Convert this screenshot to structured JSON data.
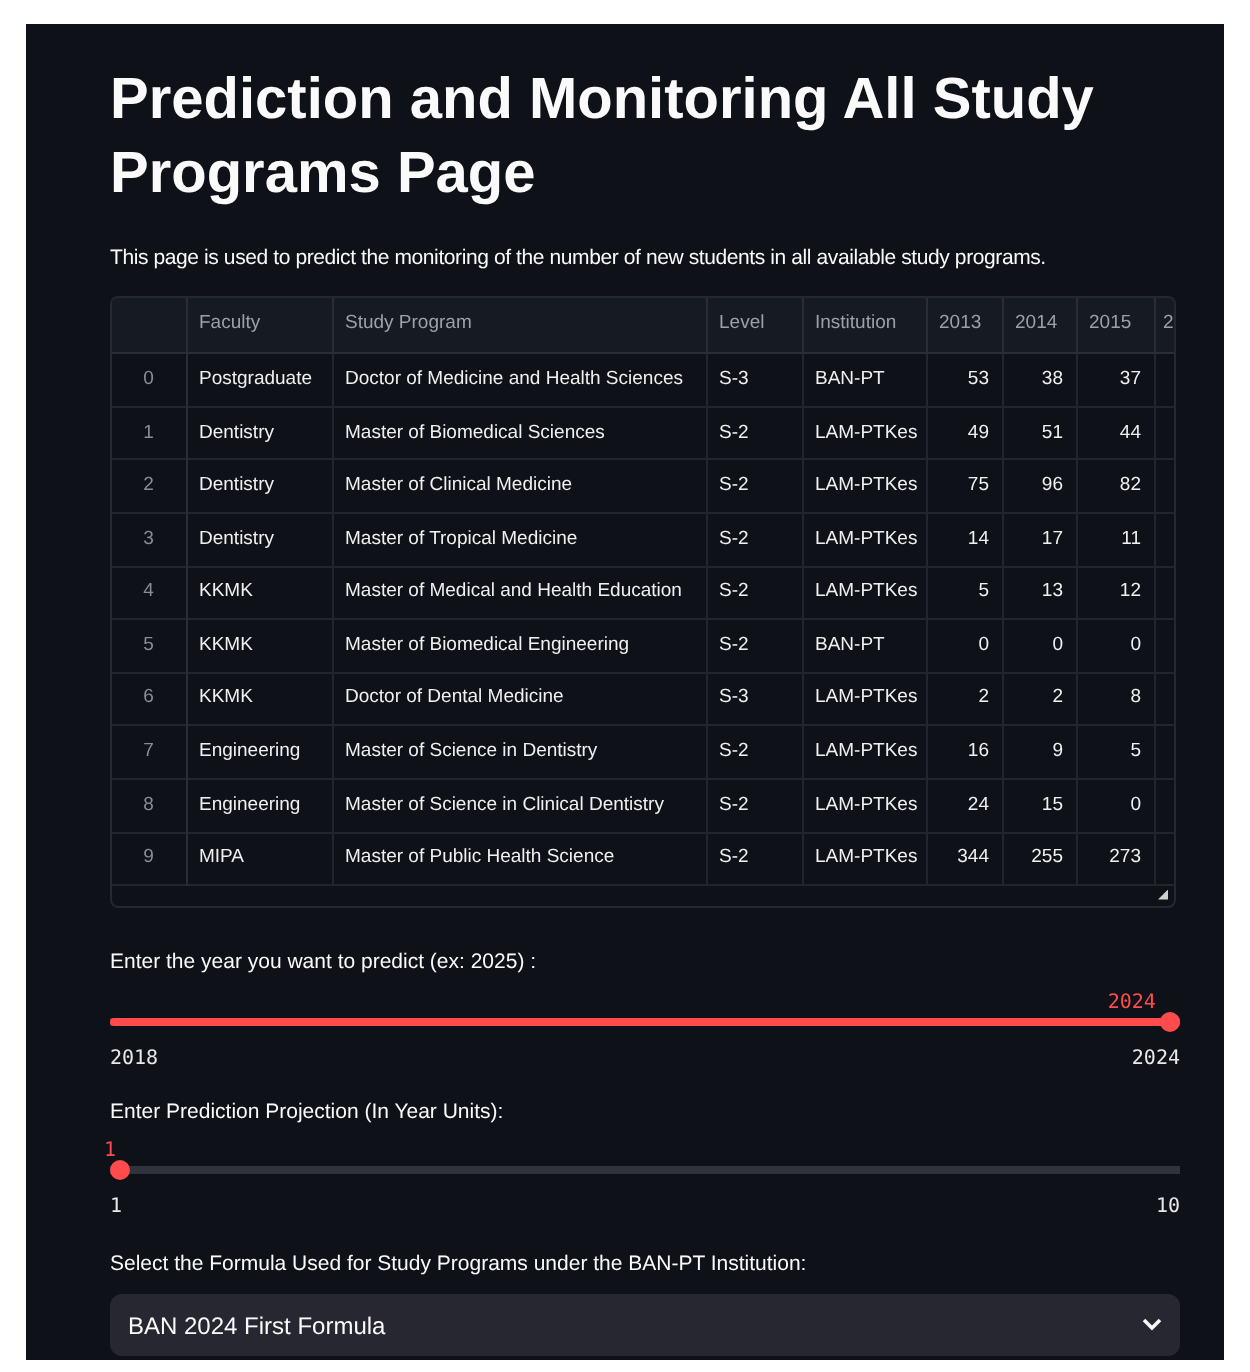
{
  "title": "Prediction and Monitoring All Study Programs Page",
  "description": "This page is used to predict the monitoring of the number of new students in all available study programs.",
  "table": {
    "columns": [
      "Faculty",
      "Study Program",
      "Level",
      "Institution",
      "2013",
      "2014",
      "2015",
      "2"
    ],
    "rows": [
      {
        "index": "0",
        "cells": [
          "Postgraduate",
          "Doctor of Medicine and Health Sciences",
          "S-3",
          "BAN-PT",
          "53",
          "38",
          "37"
        ]
      },
      {
        "index": "1",
        "cells": [
          "Dentistry",
          "Master of Biomedical Sciences",
          "S-2",
          "LAM-PTKes",
          "49",
          "51",
          "44"
        ]
      },
      {
        "index": "2",
        "cells": [
          "Dentistry",
          "Master of Clinical Medicine",
          "S-2",
          "LAM-PTKes",
          "75",
          "96",
          "82"
        ]
      },
      {
        "index": "3",
        "cells": [
          "Dentistry",
          "Master of Tropical Medicine",
          "S-2",
          "LAM-PTKes",
          "14",
          "17",
          "11"
        ]
      },
      {
        "index": "4",
        "cells": [
          "KKMK",
          "Master of Medical and Health Education",
          "S-2",
          "LAM-PTKes",
          "5",
          "13",
          "12"
        ]
      },
      {
        "index": "5",
        "cells": [
          "KKMK",
          "Master of Biomedical Engineering",
          "S-2",
          "BAN-PT",
          "0",
          "0",
          "0"
        ]
      },
      {
        "index": "6",
        "cells": [
          "KKMK",
          "Doctor of Dental Medicine",
          "S-3",
          "LAM-PTKes",
          "2",
          "2",
          "8"
        ]
      },
      {
        "index": "7",
        "cells": [
          "Engineering",
          "Master of Science in Dentistry",
          "S-2",
          "LAM-PTKes",
          "16",
          "9",
          "5"
        ]
      },
      {
        "index": "8",
        "cells": [
          "Engineering",
          "Master of Science in Clinical Dentistry",
          "S-2",
          "LAM-PTKes",
          "24",
          "15",
          "0"
        ]
      },
      {
        "index": "9",
        "cells": [
          "MIPA",
          "Master of Public Health Science",
          "S-2",
          "LAM-PTKes",
          "344",
          "255",
          "273"
        ]
      }
    ]
  },
  "sliders": [
    {
      "label": "Enter the year you want to predict (ex: 2025) :",
      "value": "2024",
      "min": "2018",
      "max": "2024",
      "level": 1
    },
    {
      "label": "Enter Prediction Projection (In Year Units):",
      "value": "1",
      "min": "1",
      "max": "10",
      "level": 0
    }
  ],
  "select": {
    "label": "Select the Formula Used for Study Programs under the BAN-PT Institution:",
    "value": "BAN 2024 First Formula"
  }
}
